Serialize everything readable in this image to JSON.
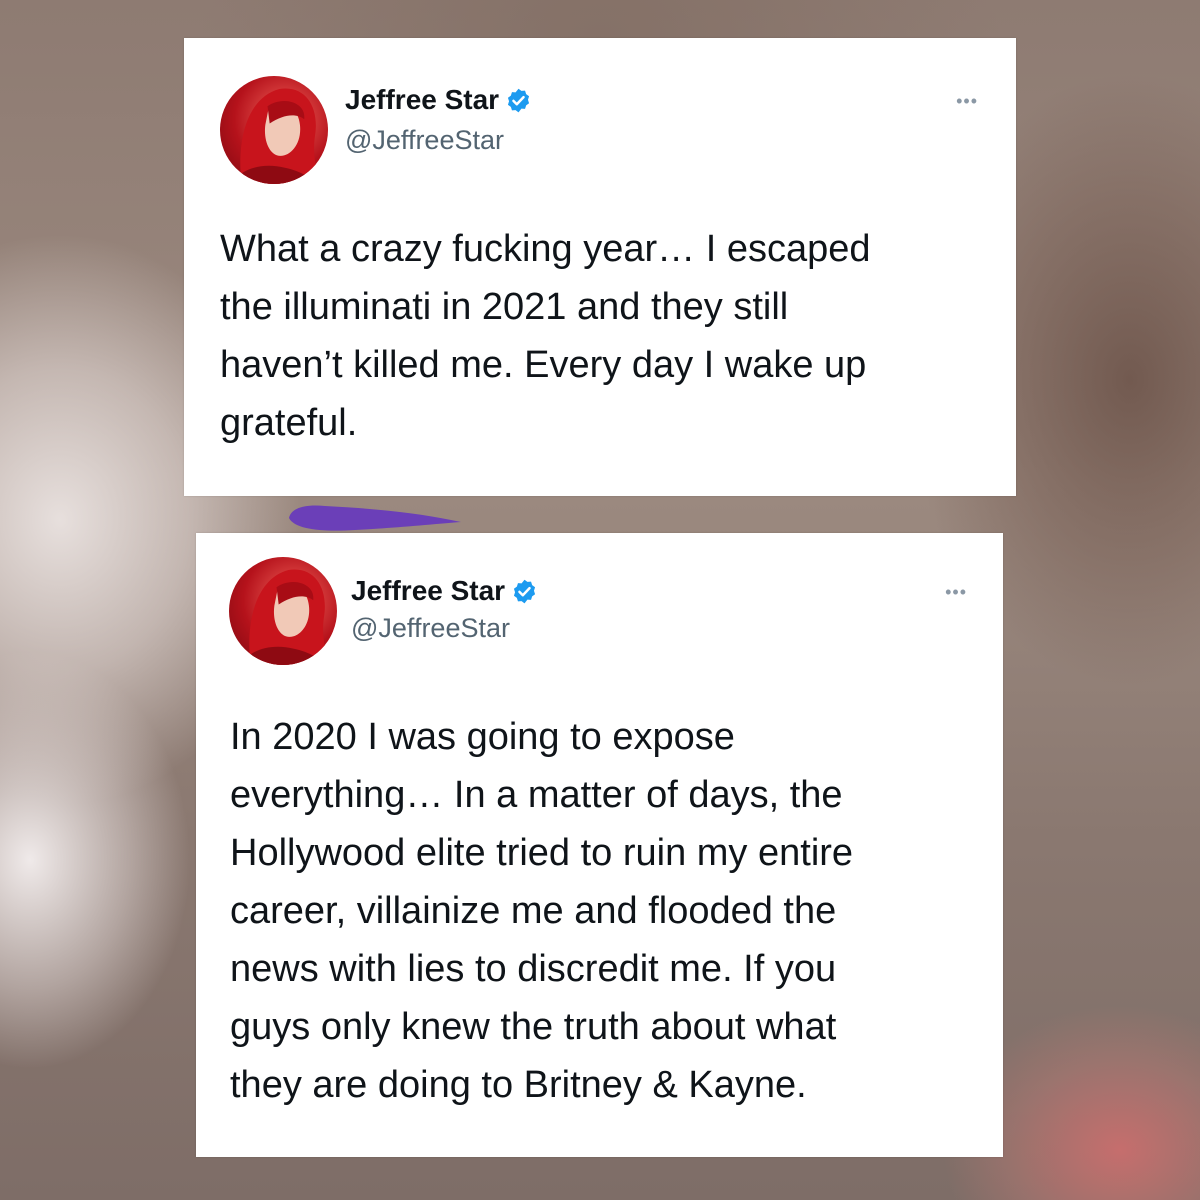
{
  "tweets": [
    {
      "author_name": "Jeffree Star",
      "handle": "@JeffreeStar",
      "verified": true,
      "more_icon": "•••",
      "text": "What a crazy fucking year… I escaped\nthe illuminati in 2021 and they still\nhaven’t killed me. Every day I wake up\ngrateful."
    },
    {
      "author_name": "Jeffree Star",
      "handle": "@JeffreeStar",
      "verified": true,
      "more_icon": "•••",
      "text": "In 2020 I was going to expose\neverything… In a matter of days, the\nHollywood elite tried to ruin my entire\ncareer, villainize me and flooded the\nnews with lies to discredit me. If you\nguys only knew the truth about what\nthey are doing to Britney & Kayne."
    }
  ],
  "colors": {
    "verified_badge": "#1d9bf0",
    "name_text": "#0f1419",
    "handle_text": "#536471",
    "purple_mark": "#6b3fb8"
  },
  "icons": {
    "verified": "verified-badge-icon",
    "more": "more-options-icon"
  }
}
